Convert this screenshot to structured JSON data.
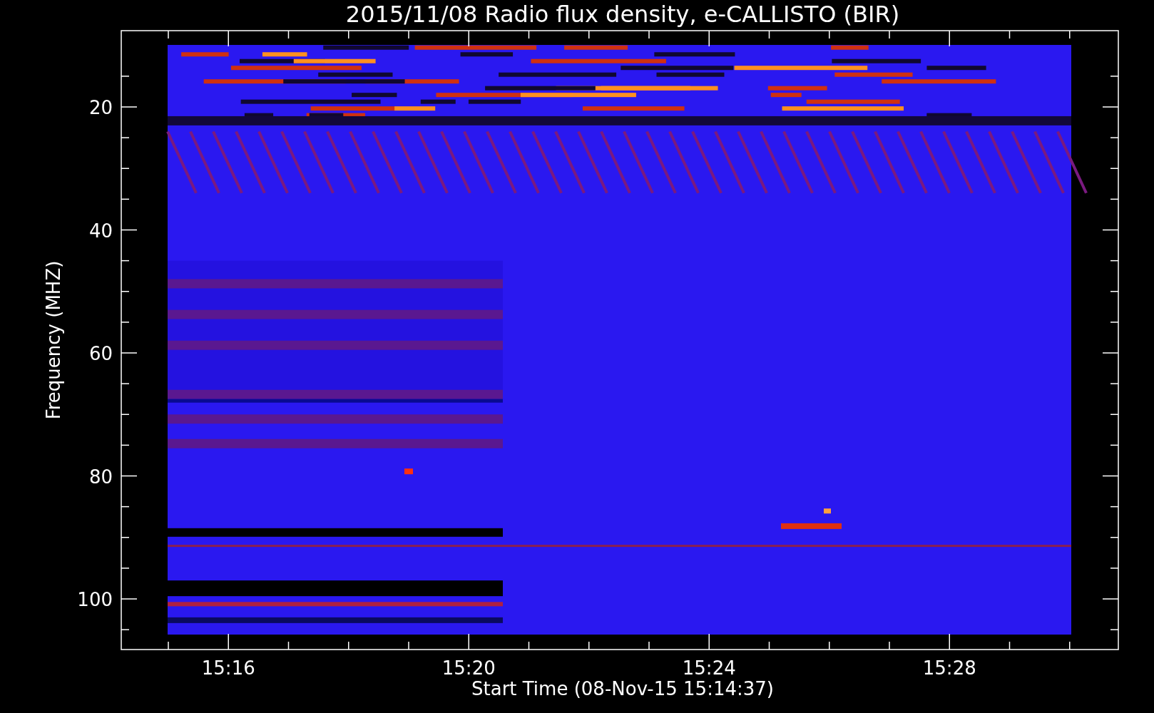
{
  "title": "2015/11/08  Radio flux density, e-CALLISTO (BIR)",
  "y_axis": {
    "label": "Frequency (MHZ)",
    "ticks": [
      "20",
      "40",
      "60",
      "80",
      "100"
    ]
  },
  "x_axis": {
    "label": "Start Time (08-Nov-15 15:14:37)",
    "ticks": [
      "15:16",
      "15:20",
      "15:24",
      "15:28"
    ]
  }
}
